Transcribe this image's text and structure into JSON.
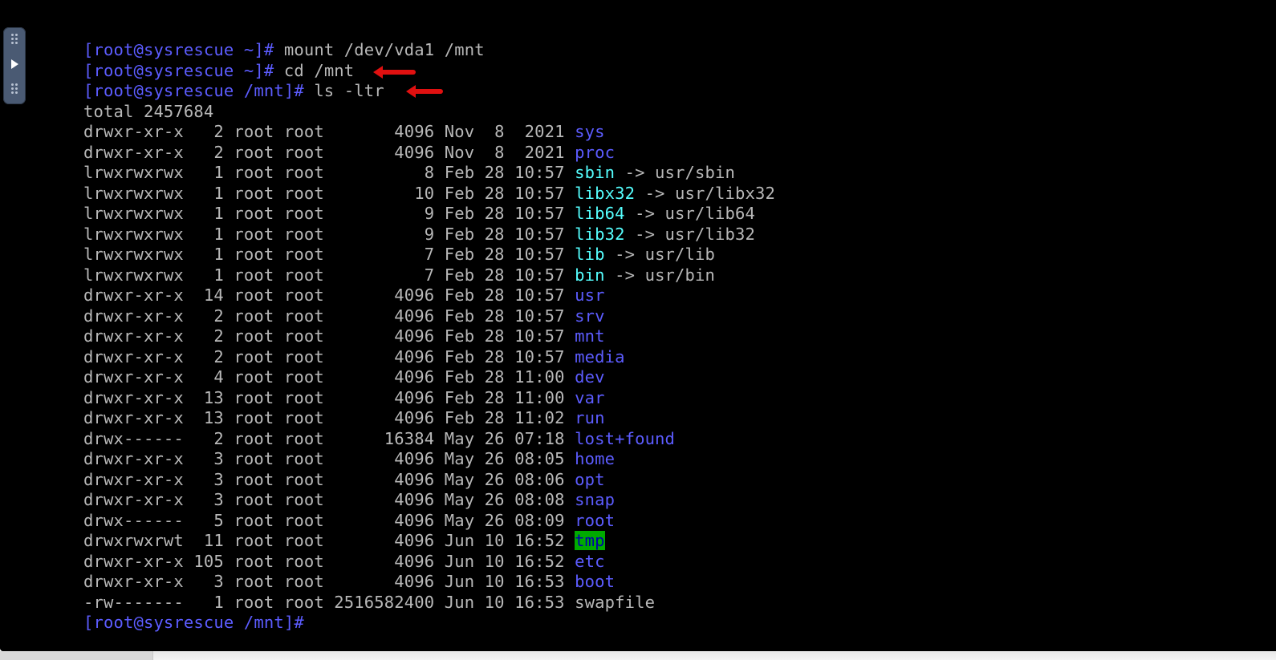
{
  "terminal": {
    "lines": [
      {
        "type": "command",
        "prompt": "[root@sysrescue ~]#",
        "command": " mount /dev/vda1 /mnt"
      },
      {
        "type": "command",
        "prompt": "[root@sysrescue ~]#",
        "command": " cd /mnt"
      },
      {
        "type": "command",
        "prompt": "[root@sysrescue /mnt]#",
        "command": " ls -ltr"
      },
      {
        "type": "text",
        "text": "total 2457684"
      },
      {
        "type": "entry",
        "meta": "drwxr-xr-x   2 root root       4096 Nov  8  2021 ",
        "name": "sys",
        "kind": "dir"
      },
      {
        "type": "entry",
        "meta": "drwxr-xr-x   2 root root       4096 Nov  8  2021 ",
        "name": "proc",
        "kind": "dir"
      },
      {
        "type": "entry",
        "meta": "lrwxrwxrwx   1 root root          8 Feb 28 10:57 ",
        "name": "sbin",
        "kind": "link",
        "target": " -> usr/sbin"
      },
      {
        "type": "entry",
        "meta": "lrwxrwxrwx   1 root root         10 Feb 28 10:57 ",
        "name": "libx32",
        "kind": "link",
        "target": " -> usr/libx32"
      },
      {
        "type": "entry",
        "meta": "lrwxrwxrwx   1 root root          9 Feb 28 10:57 ",
        "name": "lib64",
        "kind": "link",
        "target": " -> usr/lib64"
      },
      {
        "type": "entry",
        "meta": "lrwxrwxrwx   1 root root          9 Feb 28 10:57 ",
        "name": "lib32",
        "kind": "link",
        "target": " -> usr/lib32"
      },
      {
        "type": "entry",
        "meta": "lrwxrwxrwx   1 root root          7 Feb 28 10:57 ",
        "name": "lib",
        "kind": "link",
        "target": " -> usr/lib"
      },
      {
        "type": "entry",
        "meta": "lrwxrwxrwx   1 root root          7 Feb 28 10:57 ",
        "name": "bin",
        "kind": "link",
        "target": " -> usr/bin"
      },
      {
        "type": "entry",
        "meta": "drwxr-xr-x  14 root root       4096 Feb 28 10:57 ",
        "name": "usr",
        "kind": "dir"
      },
      {
        "type": "entry",
        "meta": "drwxr-xr-x   2 root root       4096 Feb 28 10:57 ",
        "name": "srv",
        "kind": "dir"
      },
      {
        "type": "entry",
        "meta": "drwxr-xr-x   2 root root       4096 Feb 28 10:57 ",
        "name": "mnt",
        "kind": "dir"
      },
      {
        "type": "entry",
        "meta": "drwxr-xr-x   2 root root       4096 Feb 28 10:57 ",
        "name": "media",
        "kind": "dir"
      },
      {
        "type": "entry",
        "meta": "drwxr-xr-x   4 root root       4096 Feb 28 11:00 ",
        "name": "dev",
        "kind": "dir"
      },
      {
        "type": "entry",
        "meta": "drwxr-xr-x  13 root root       4096 Feb 28 11:00 ",
        "name": "var",
        "kind": "dir"
      },
      {
        "type": "entry",
        "meta": "drwxr-xr-x  13 root root       4096 Feb 28 11:02 ",
        "name": "run",
        "kind": "dir"
      },
      {
        "type": "entry",
        "meta": "drwx------   2 root root      16384 May 26 07:18 ",
        "name": "lost+found",
        "kind": "dir"
      },
      {
        "type": "entry",
        "meta": "drwxr-xr-x   3 root root       4096 May 26 08:05 ",
        "name": "home",
        "kind": "dir"
      },
      {
        "type": "entry",
        "meta": "drwxr-xr-x   3 root root       4096 May 26 08:06 ",
        "name": "opt",
        "kind": "dir"
      },
      {
        "type": "entry",
        "meta": "drwxr-xr-x   3 root root       4096 May 26 08:08 ",
        "name": "snap",
        "kind": "dir"
      },
      {
        "type": "entry",
        "meta": "drwx------   5 root root       4096 May 26 08:09 ",
        "name": "root",
        "kind": "dir"
      },
      {
        "type": "entry",
        "meta": "drwxrwxrwt  11 root root       4096 Jun 10 16:52 ",
        "name": "tmp",
        "kind": "sticky"
      },
      {
        "type": "entry",
        "meta": "drwxr-xr-x 105 root root       4096 Jun 10 16:52 ",
        "name": "etc",
        "kind": "dir"
      },
      {
        "type": "entry",
        "meta": "drwxr-xr-x   3 root root       4096 Jun 10 16:53 ",
        "name": "boot",
        "kind": "dir"
      },
      {
        "type": "entry",
        "meta": "-rw-------   1 root root 2516582400 Jun 10 16:53 ",
        "name": "swapfile",
        "kind": "file"
      },
      {
        "type": "command",
        "prompt": "[root@sysrescue /mnt]#",
        "command": ""
      }
    ]
  },
  "side_handle": {
    "icon": "play-icon"
  },
  "colors": {
    "background": "#000000",
    "text": "#b8b8b8",
    "prompt": "#5c5cff",
    "directory": "#5c5cff",
    "symlink": "#55ffff",
    "sticky_bg": "#00aa00",
    "sticky_fg": "#0000aa",
    "annotation_arrow": "#e01010"
  }
}
